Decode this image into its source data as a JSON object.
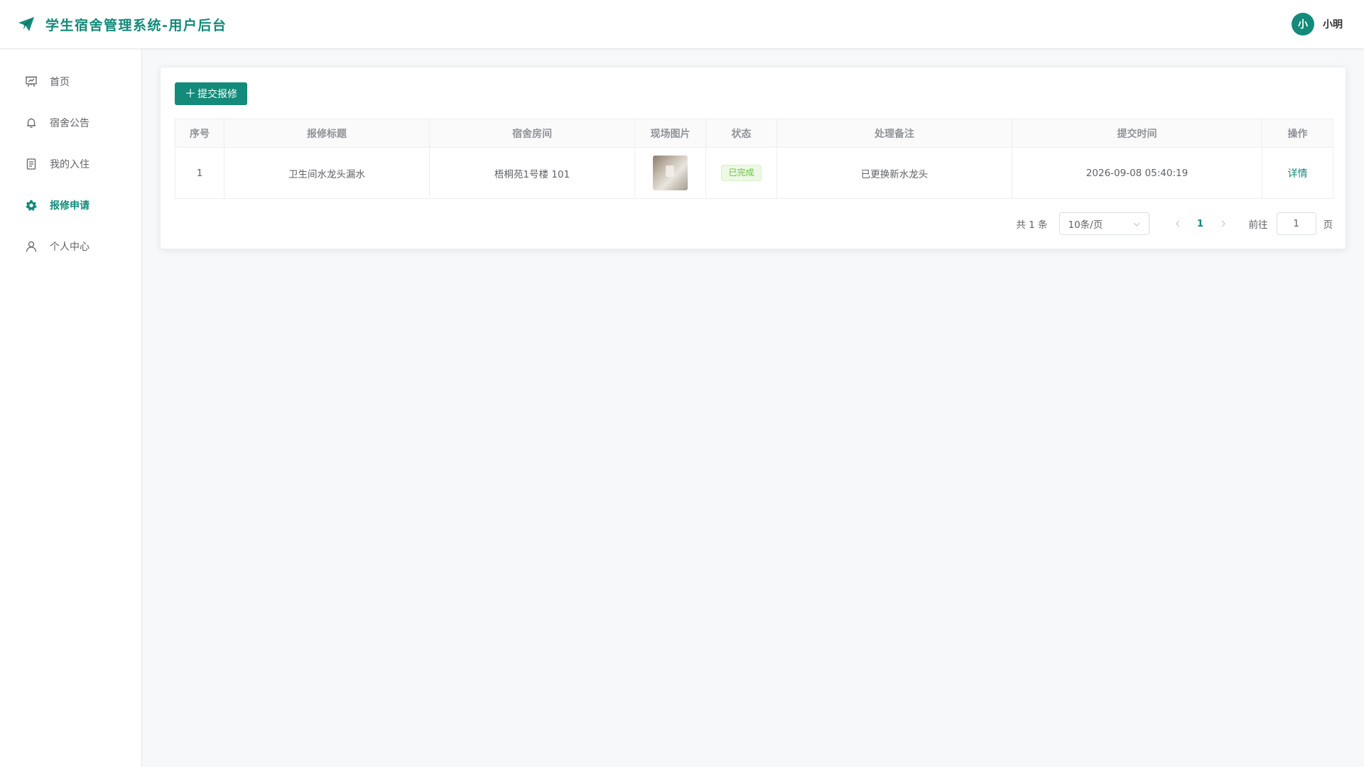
{
  "header": {
    "title": "学生宿舍管理系统-用户后台",
    "user_avatar_text": "小",
    "user_name": "小明"
  },
  "sidebar": {
    "items": [
      {
        "label": "首页",
        "icon": "presentation-icon",
        "active": false
      },
      {
        "label": "宿舍公告",
        "icon": "bell-icon",
        "active": false
      },
      {
        "label": "我的入住",
        "icon": "document-icon",
        "active": false
      },
      {
        "label": "报修申请",
        "icon": "gear-icon",
        "active": true
      },
      {
        "label": "个人中心",
        "icon": "user-icon",
        "active": false
      }
    ]
  },
  "toolbar": {
    "submit_label": "提交报修"
  },
  "table": {
    "columns": [
      "序号",
      "报修标题",
      "宿舍房间",
      "现场图片",
      "状态",
      "处理备注",
      "提交时间",
      "操作"
    ],
    "rows": [
      {
        "index": "1",
        "title": "卫生间水龙头漏水",
        "room": "梧桐苑1号楼 101",
        "status": "已完成",
        "note": "已更换新水龙头",
        "submitted_at": "2026-09-08 05:40:19",
        "action": "详情"
      }
    ]
  },
  "pagination": {
    "total_text": "共 1 条",
    "page_size": "10条/页",
    "current_page": "1",
    "goto_label": "前往",
    "goto_value": "1",
    "goto_suffix": "页"
  },
  "colors": {
    "primary": "#138a7a",
    "success": "#67c23a",
    "background": "#f7f8fa"
  }
}
